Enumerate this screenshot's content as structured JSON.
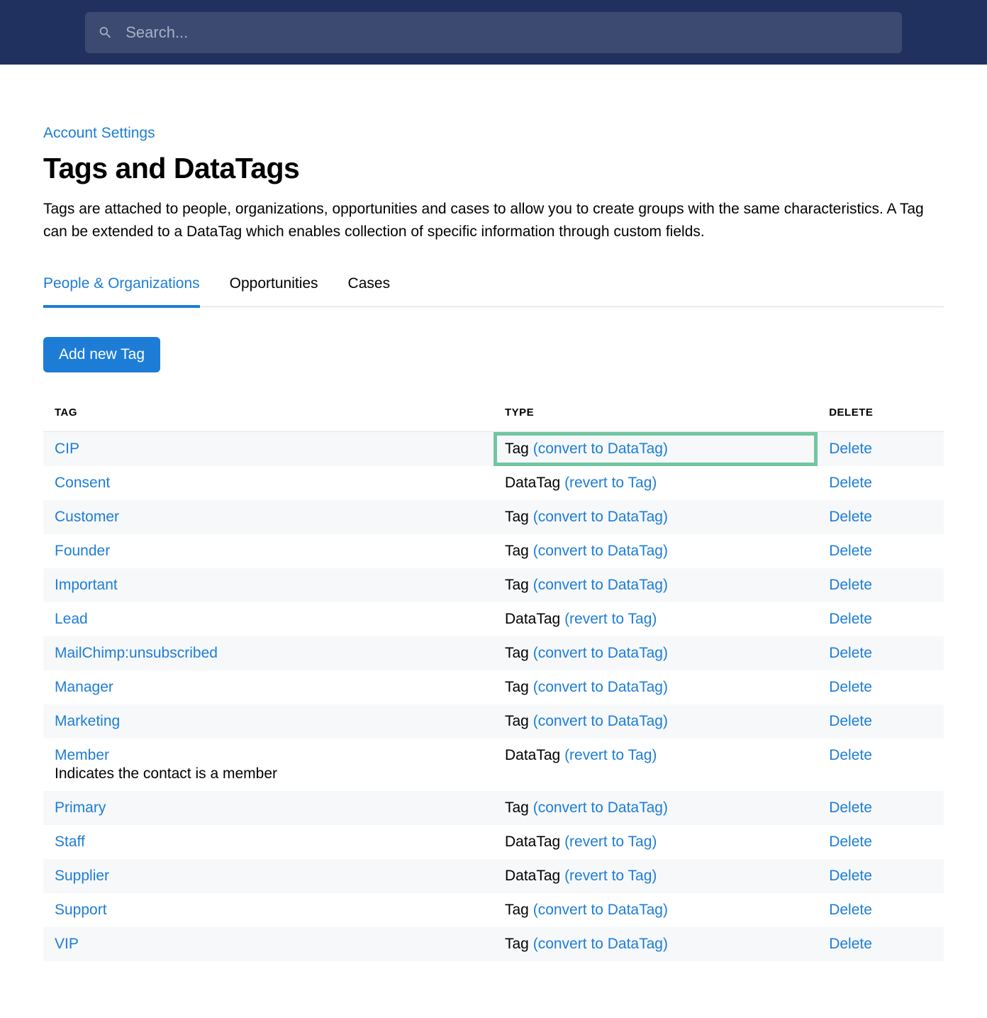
{
  "search": {
    "placeholder": "Search..."
  },
  "breadcrumb": {
    "label": "Account Settings"
  },
  "page": {
    "title": "Tags and DataTags",
    "description": "Tags are attached to people, organizations, opportunities and cases to allow you to create groups with the same characteristics. A Tag can be extended to a DataTag which enables collection of specific information through custom fields."
  },
  "tabs": [
    {
      "label": "People & Organizations",
      "active": true
    },
    {
      "label": "Opportunities",
      "active": false
    },
    {
      "label": "Cases",
      "active": false
    }
  ],
  "add_button_label": "Add new Tag",
  "table_headers": {
    "tag": "TAG",
    "type": "TYPE",
    "delete": "DELETE"
  },
  "action_convert": "(convert to DataTag)",
  "action_revert": "(revert to Tag)",
  "type_tag": "Tag",
  "type_datatag": "DataTag",
  "delete_label": "Delete",
  "rows": [
    {
      "name": "CIP",
      "type": "Tag",
      "action": "(convert to DataTag)",
      "highlight": true
    },
    {
      "name": "Consent",
      "type": "DataTag",
      "action": "(revert to Tag)"
    },
    {
      "name": "Customer",
      "type": "Tag",
      "action": "(convert to DataTag)"
    },
    {
      "name": "Founder",
      "type": "Tag",
      "action": "(convert to DataTag)"
    },
    {
      "name": "Important",
      "type": "Tag",
      "action": "(convert to DataTag)"
    },
    {
      "name": "Lead",
      "type": "DataTag",
      "action": "(revert to Tag)"
    },
    {
      "name": "MailChimp:unsubscribed",
      "type": "Tag",
      "action": "(convert to DataTag)"
    },
    {
      "name": "Manager",
      "type": "Tag",
      "action": "(convert to DataTag)"
    },
    {
      "name": "Marketing",
      "type": "Tag",
      "action": "(convert to DataTag)"
    },
    {
      "name": "Member",
      "desc": "Indicates the contact is a member",
      "type": "DataTag",
      "action": "(revert to Tag)"
    },
    {
      "name": "Primary",
      "type": "Tag",
      "action": "(convert to DataTag)"
    },
    {
      "name": "Staff",
      "type": "DataTag",
      "action": "(revert to Tag)"
    },
    {
      "name": "Supplier",
      "type": "DataTag",
      "action": "(revert to Tag)"
    },
    {
      "name": "Support",
      "type": "Tag",
      "action": "(convert to DataTag)"
    },
    {
      "name": "VIP",
      "type": "Tag",
      "action": "(convert to DataTag)"
    }
  ]
}
